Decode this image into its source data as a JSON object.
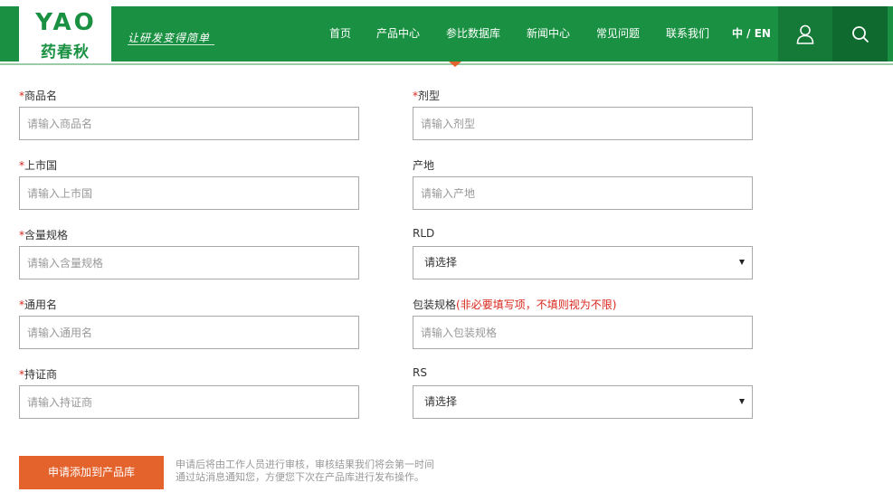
{
  "brand": {
    "logo_text": "YAO",
    "logo_cn": "药春秋",
    "slogan": "让研发变得简单",
    "color": "#1a9142",
    "accent": "#e4632d"
  },
  "nav": {
    "items": [
      {
        "label": "首页"
      },
      {
        "label": "产品中心"
      },
      {
        "label": "参比数据库"
      },
      {
        "label": "新闻中心"
      },
      {
        "label": "常见问题"
      },
      {
        "label": "联系我们"
      }
    ],
    "lang": "中 / EN",
    "user_icon": "user-icon",
    "search_icon": "search-icon"
  },
  "form": {
    "required_mark": "*",
    "product_name": {
      "label": "商品名",
      "placeholder": "请输入商品名"
    },
    "dosage_form": {
      "label": "剂型",
      "placeholder": "请输入剂型"
    },
    "market_country": {
      "label": "上市国",
      "placeholder": "请输入上市国"
    },
    "origin": {
      "label": "产地",
      "placeholder": "请输入产地"
    },
    "strength": {
      "label": "含量规格",
      "placeholder": "请输入含量规格"
    },
    "rld": {
      "label": "RLD",
      "value": "请选择"
    },
    "generic_name": {
      "label": "通用名",
      "placeholder": "请输入通用名"
    },
    "package_spec": {
      "label": "包装规格",
      "hint": "(非必要填写项，不填则视为不限)",
      "placeholder": "请输入包装规格"
    },
    "license_holder": {
      "label": "持证商",
      "placeholder": "请输入持证商"
    },
    "rs": {
      "label": "RS",
      "value": "请选择"
    },
    "submit_label": "申请添加到产品库",
    "note_line1": "申请后将由工作人员进行审核，审核结果我们将会第一时间",
    "note_line2": "通过站消息通知您，方便您下次在产品库进行发布操作。"
  }
}
